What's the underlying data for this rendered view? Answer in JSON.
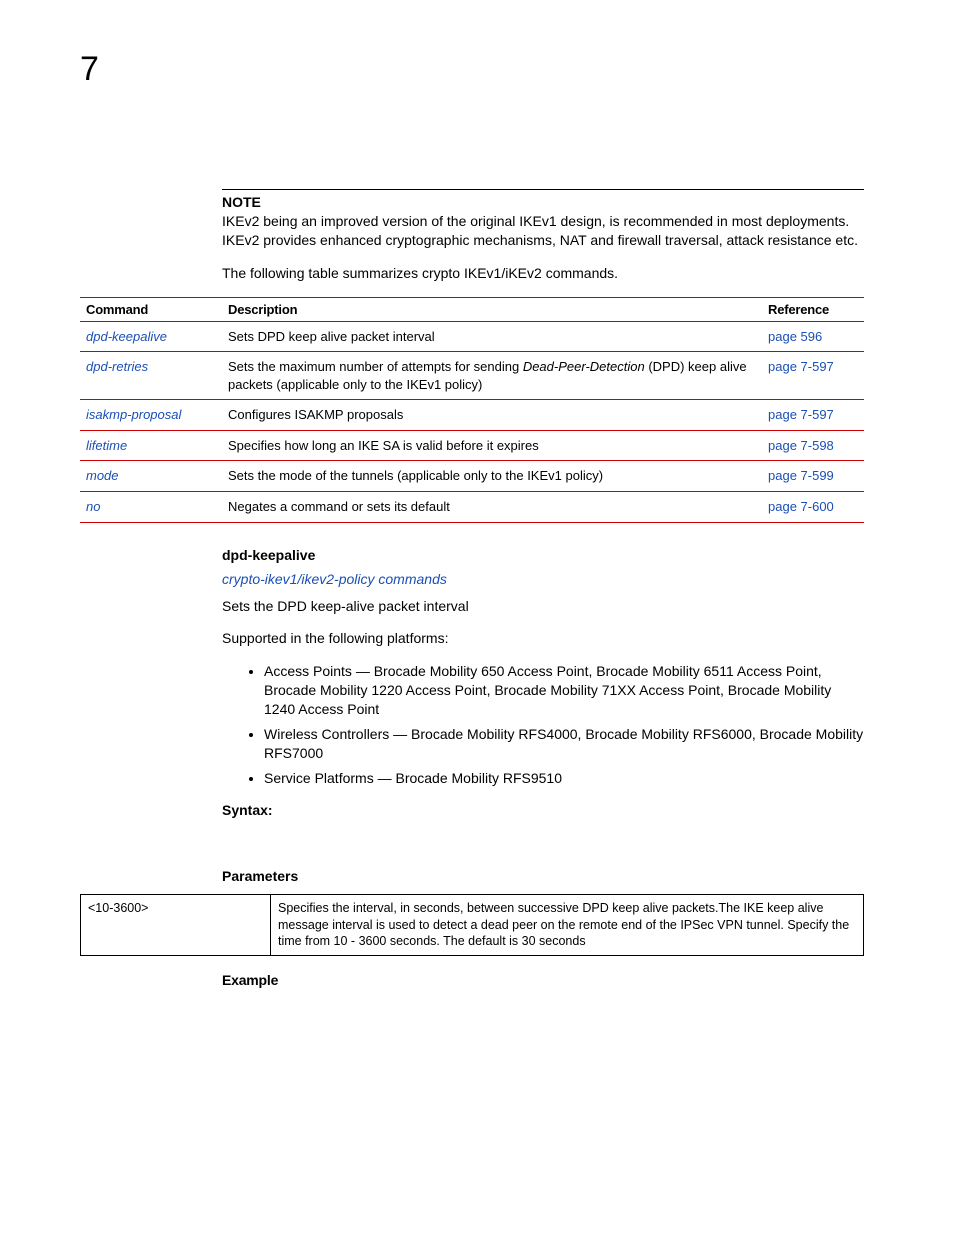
{
  "chapter_number": "7",
  "note": {
    "label": "NOTE",
    "text": "IKEv2 being an improved version of the original IKEv1 design, is recommended in most deployments. IKEv2 provides enhanced cryptographic mechanisms, NAT and firewall traversal, attack resistance etc."
  },
  "intro_text": "The following table summarizes crypto IKEv1/iKEv2 commands.",
  "table": {
    "headers": {
      "command": "Command",
      "description": "Description",
      "reference": "Reference"
    },
    "rows": [
      {
        "command": "dpd-keepalive",
        "description": "Sets DPD keep alive packet interval",
        "reference": "page 596"
      },
      {
        "command": "dpd-retries",
        "description_pre": "Sets the maximum number of attempts for sending ",
        "description_em": "Dead-Peer-Detection",
        "description_post": " (DPD) keep alive packets (applicable only to the IKEv1 policy)",
        "reference": "page 7-597"
      },
      {
        "command": "isakmp-proposal",
        "description": "Configures ISAKMP proposals",
        "reference": "page 7-597"
      },
      {
        "command": "lifetime",
        "description": "Specifies how long an IKE SA is valid before it expires",
        "reference": "page 7-598"
      },
      {
        "command": "mode",
        "description": "Sets the mode of the tunnels (applicable only to the IKEv1 policy)",
        "reference": "page 7-599"
      },
      {
        "command": "no",
        "description": "Negates a command or sets its default",
        "reference": "page 7-600"
      }
    ]
  },
  "section": {
    "heading": "dpd-keepalive",
    "sublink": "crypto-ikev1/ikev2-policy commands",
    "desc1": "Sets the DPD keep-alive packet interval",
    "desc2": "Supported in the following platforms:",
    "bullets": [
      "Access Points — Brocade Mobility 650 Access Point, Brocade Mobility 6511 Access Point, Brocade Mobility 1220 Access Point, Brocade Mobility 71XX Access Point, Brocade Mobility 1240 Access Point",
      "Wireless Controllers — Brocade Mobility RFS4000, Brocade Mobility RFS6000, Brocade Mobility RFS7000",
      "Service Platforms — Brocade Mobility RFS9510"
    ],
    "syntax_label": "Syntax:",
    "params_label": "Parameters",
    "param_table": {
      "name": "<10-3600>",
      "desc": "Specifies the interval, in seconds, between successive DPD keep alive packets.The IKE keep alive message interval is used to detect a dead peer on the remote end of the IPSec VPN tunnel. Specify the time from 10 - 3600 seconds. The default is 30 seconds"
    },
    "example_label": "Example"
  }
}
